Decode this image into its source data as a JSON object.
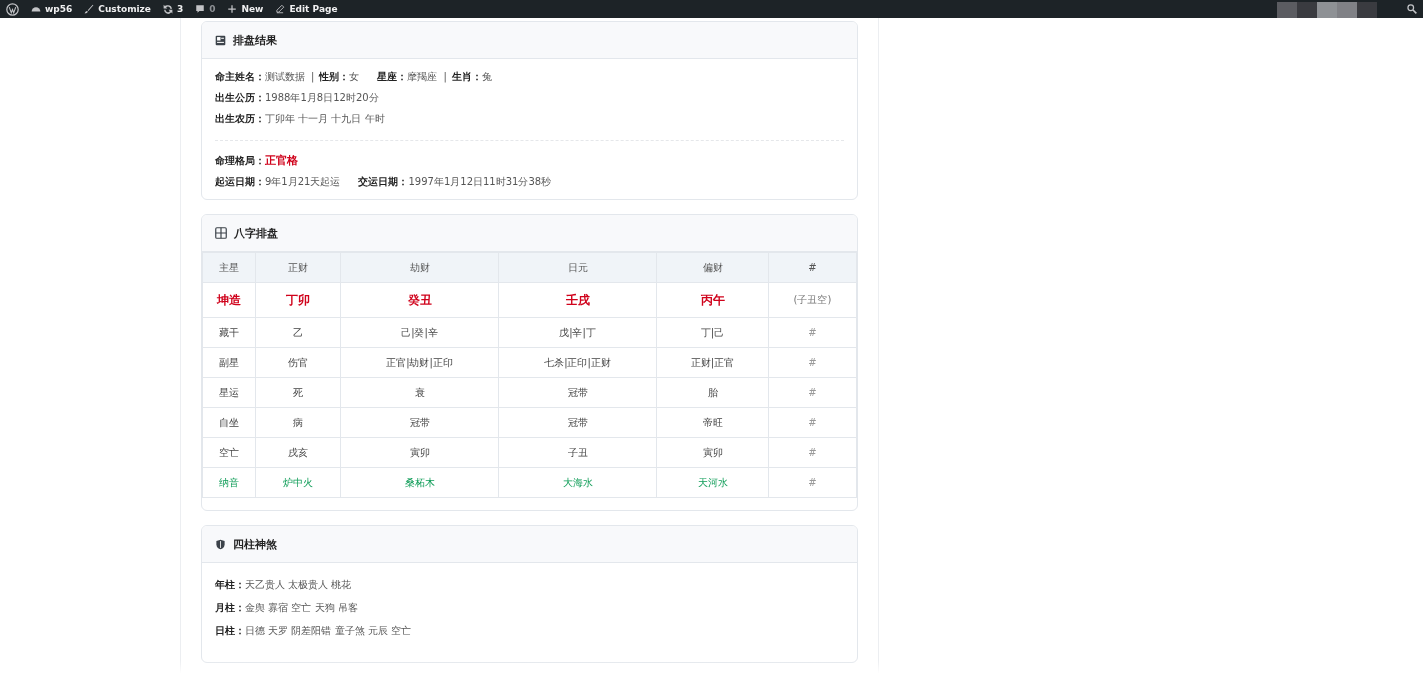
{
  "admin_bar": {
    "items": [
      {
        "kind": "logo"
      },
      {
        "kind": "site",
        "label": "wp56"
      },
      {
        "kind": "customize",
        "label": "Customize"
      },
      {
        "kind": "updates",
        "label": "3"
      },
      {
        "kind": "comments",
        "label": "0"
      },
      {
        "kind": "new",
        "label": "New"
      },
      {
        "kind": "edit",
        "label": "Edit Page"
      }
    ]
  },
  "result_card": {
    "title": "排盘结果",
    "lines": [
      [
        {
          "kind": "label",
          "text": "命主姓名："
        },
        {
          "kind": "value",
          "text": "测试数据"
        },
        {
          "kind": "sep",
          "text": "|"
        },
        {
          "kind": "label",
          "text": "性别："
        },
        {
          "kind": "value",
          "text": "女"
        },
        {
          "kind": "gap"
        },
        {
          "kind": "label",
          "text": "星座："
        },
        {
          "kind": "value",
          "text": "摩羯座"
        },
        {
          "kind": "sep",
          "text": "|"
        },
        {
          "kind": "label",
          "text": "生肖："
        },
        {
          "kind": "value",
          "text": "兔"
        }
      ],
      [
        {
          "kind": "label",
          "text": "出生公历："
        },
        {
          "kind": "value",
          "text": "1988年1月8日12时20分"
        }
      ],
      [
        {
          "kind": "label",
          "text": "出生农历："
        },
        {
          "kind": "value",
          "text": "丁卯年 十一月 十九日 午时"
        }
      ],
      [
        {
          "kind": "divider"
        }
      ],
      [
        {
          "kind": "label",
          "text": "命理格局："
        },
        {
          "kind": "accent",
          "text": "正官格"
        }
      ],
      [
        {
          "kind": "label",
          "text": "起运日期："
        },
        {
          "kind": "value",
          "text": "9年1月21天起运"
        },
        {
          "kind": "gap"
        },
        {
          "kind": "label",
          "text": "交运日期："
        },
        {
          "kind": "value",
          "text": "1997年1月12日11时31分38秒"
        }
      ]
    ]
  },
  "bazi_card": {
    "title": "八字排盘",
    "rows": [
      {
        "kind": "header",
        "cells": [
          "主星",
          "正财",
          "劫财",
          "日元",
          "偏财",
          "#"
        ]
      },
      {
        "kind": "pillar",
        "cells": [
          "坤造",
          "丁卯",
          "癸丑",
          "壬戌",
          "丙午",
          "(子丑空)"
        ]
      },
      {
        "kind": "normal",
        "cells": [
          "藏干",
          "乙",
          "己|癸|辛",
          "戊|辛|丁",
          "丁|己",
          "#"
        ]
      },
      {
        "kind": "normal",
        "cells": [
          "副星",
          "伤官",
          "正官|劫财|正印",
          "七杀|正印|正财",
          "正财|正官",
          "#"
        ]
      },
      {
        "kind": "normal",
        "cells": [
          "星运",
          "死",
          "衰",
          "冠带",
          "胎",
          "#"
        ]
      },
      {
        "kind": "normal",
        "cells": [
          "自坐",
          "病",
          "冠带",
          "冠带",
          "帝旺",
          "#"
        ]
      },
      {
        "kind": "normal",
        "cells": [
          "空亡",
          "戌亥",
          "寅卯",
          "子丑",
          "寅卯",
          "#"
        ]
      },
      {
        "kind": "nayin",
        "cells": [
          "纳音",
          "炉中火",
          "桑柘木",
          "大海水",
          "天河水",
          "#"
        ]
      }
    ]
  },
  "shensha_card": {
    "title": "四柱神煞",
    "lines": [
      {
        "label": "年柱：",
        "value": "天乙贵人 太极贵人 桃花"
      },
      {
        "label": "月柱：",
        "value": "金舆 寡宿 空亡 天狗 吊客"
      },
      {
        "label": "日柱：",
        "value": "日德 天罗 阴差阳错 童子煞 元辰 空亡"
      }
    ]
  }
}
